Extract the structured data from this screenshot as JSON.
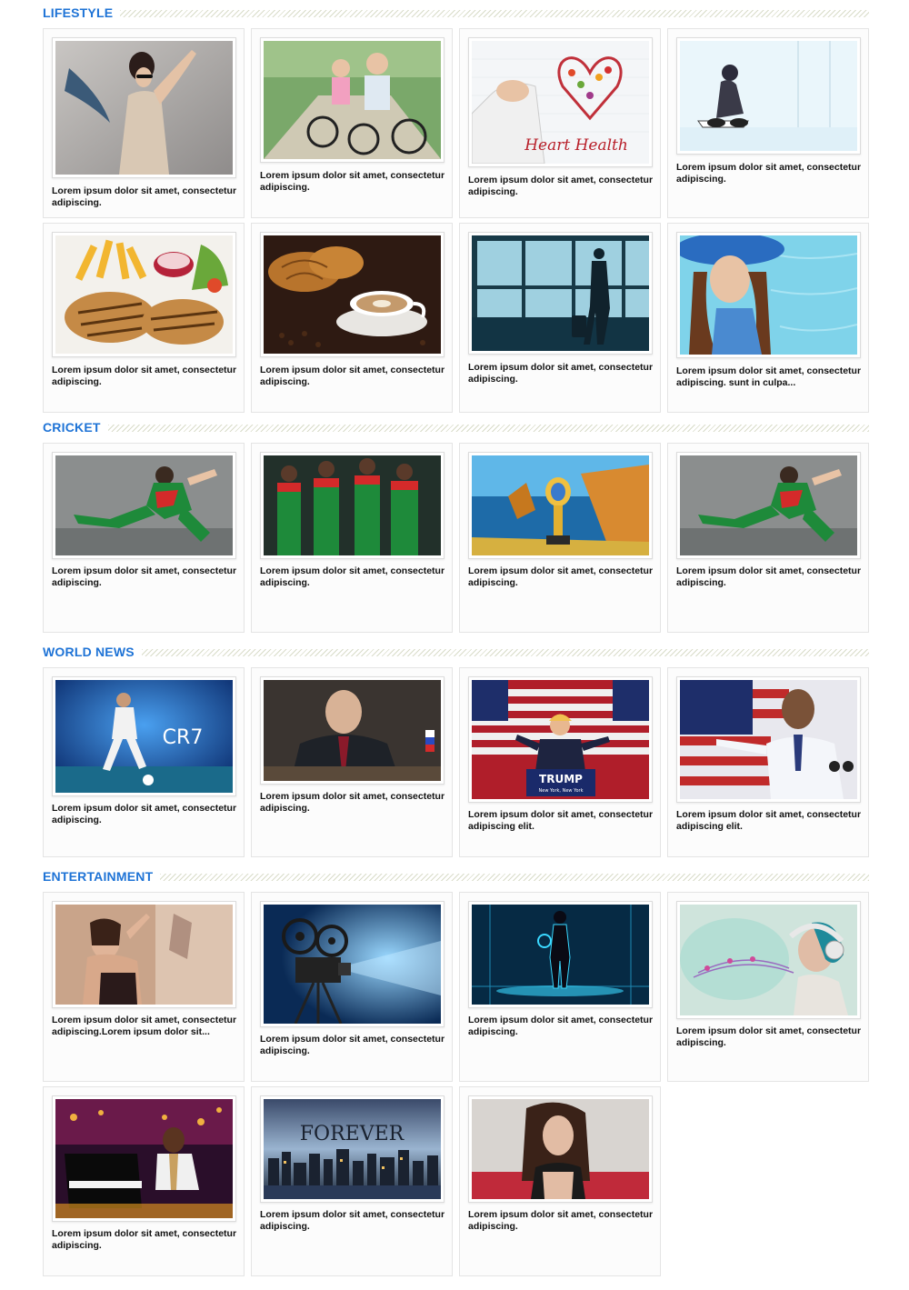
{
  "sections": {
    "lifestyle": {
      "title": "LIFESTYLE",
      "cards": [
        {
          "caption": "Lorem ipsum dolor sit amet, consectetur adipiscing.",
          "image": "fashion-woman-sunglasses"
        },
        {
          "caption": "Lorem ipsum dolor sit amet, consectetur adipiscing.",
          "image": "couple-cycling"
        },
        {
          "caption": "Lorem ipsum dolor sit amet, consectetur adipiscing.",
          "image": "heart-health",
          "image_text": "Heart Health"
        },
        {
          "caption": "Lorem ipsum dolor sit amet, consectetur adipiscing.",
          "image": "woman-stretching"
        },
        {
          "caption": "Lorem ipsum dolor sit amet, consectetur adipiscing.",
          "image": "burger-patties-fries"
        },
        {
          "caption": "Lorem ipsum dolor sit amet, consectetur adipiscing.",
          "image": "croissant-coffee"
        },
        {
          "caption": "Lorem ipsum dolor sit amet, consectetur adipiscing.",
          "image": "traveler-airport"
        },
        {
          "caption": "Lorem ipsum dolor sit amet, consectetur adipiscing. sunt in culpa...",
          "image": "woman-blue-hat"
        }
      ]
    },
    "cricket": {
      "title": "CRICKET",
      "cards": [
        {
          "caption": "Lorem ipsum dolor sit amet, consectetur adipiscing.",
          "image": "cricketer-celebrating"
        },
        {
          "caption": "Lorem ipsum dolor sit amet, consectetur adipiscing.",
          "image": "cricket-team-celebration"
        },
        {
          "caption": "Lorem ipsum dolor sit amet, consectetur adipiscing.",
          "image": "world-cup-trophy-coast"
        },
        {
          "caption": "Lorem ipsum dolor sit amet, consectetur adipiscing.",
          "image": "cricketer-celebrating"
        }
      ]
    },
    "world_news": {
      "title": "WORLD NEWS",
      "cards": [
        {
          "caption": "Lorem ipsum dolor sit amet, consectetur adipiscing.",
          "image": "footballer-cr7",
          "image_text": "CR7"
        },
        {
          "caption": "Lorem ipsum dolor sit amet, consectetur adipiscing.",
          "image": "politician-at-desk"
        },
        {
          "caption": "Lorem ipsum dolor sit amet, consectetur adipiscing elit.",
          "image": "trump-rally",
          "image_text": "TRUMP",
          "image_subtext": "New York, New York"
        },
        {
          "caption": "Lorem ipsum dolor sit amet, consectetur adipiscing elit.",
          "image": "obama-speech"
        }
      ]
    },
    "entertainment": {
      "title": "ENTERTAINMENT",
      "cards": [
        {
          "caption": "Lorem ipsum dolor sit amet, consectetur adipiscing.Lorem ipsum dolor sit...",
          "image": "actress-portrait"
        },
        {
          "caption": "Lorem ipsum dolor sit amet, consectetur adipiscing.",
          "image": "film-projector"
        },
        {
          "caption": "Lorem ipsum dolor sit amet, consectetur adipiscing.",
          "image": "tron-figure"
        },
        {
          "caption": "Lorem ipsum dolor sit amet, consectetur adipiscing.",
          "image": "woman-headphones-music"
        },
        {
          "caption": "Lorem ipsum dolor sit amet, consectetur adipiscing.",
          "image": "pianist-concert"
        },
        {
          "caption": "Lorem ipsum dolor sit amet, consectetur adipiscing.",
          "image": "forever-city-skyline",
          "image_text": "FOREVER"
        },
        {
          "caption": "Lorem ipsum dolor sit amet, consectetur adipiscing.",
          "image": "woman-portrait-red"
        }
      ]
    }
  },
  "colors": {
    "section_title": "#1e73d6",
    "caption": "#111111",
    "card_border": "#e4e4e4"
  }
}
